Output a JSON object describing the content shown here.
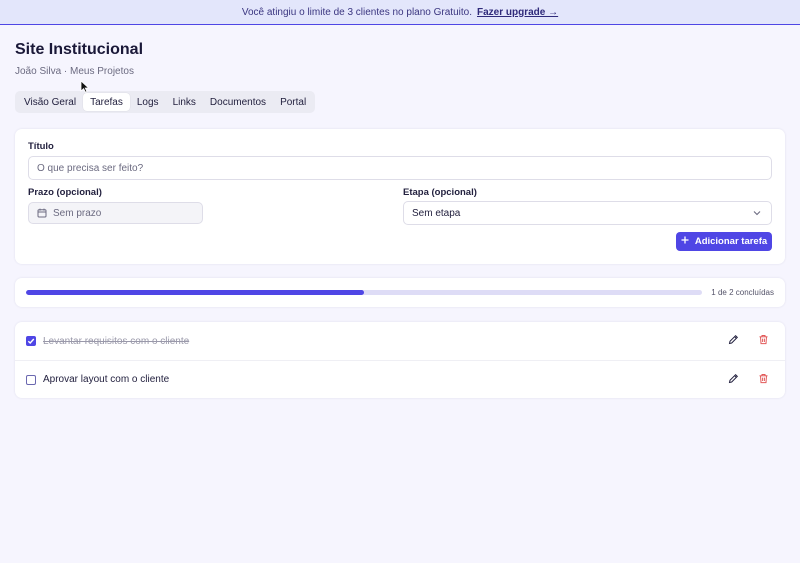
{
  "banner": {
    "message": "Você atingiu o limite de 3 clientes no plano Gratuito.",
    "link": "Fazer upgrade →"
  },
  "header": {
    "title": "Site Institucional",
    "breadcrumb": "João Silva · Meus Projetos"
  },
  "tabs": [
    {
      "label": "Visão Geral",
      "active": false
    },
    {
      "label": "Tarefas",
      "active": true
    },
    {
      "label": "Logs",
      "active": false
    },
    {
      "label": "Links",
      "active": false
    },
    {
      "label": "Documentos",
      "active": false
    },
    {
      "label": "Portal",
      "active": false
    }
  ],
  "form": {
    "title_label": "Título",
    "title_placeholder": "O que precisa ser feito?",
    "due_label": "Prazo (opcional)",
    "due_value": "Sem prazo",
    "stage_label": "Etapa (opcional)",
    "stage_value": "Sem etapa",
    "add_button": "Adicionar tarefa"
  },
  "progress": {
    "completed": 1,
    "total": 2,
    "text": "1 de 2 concluídas"
  },
  "tasks": [
    {
      "text": "Levantar requisitos com o cliente",
      "done": true
    },
    {
      "text": "Aprovar layout com o cliente",
      "done": false
    }
  ],
  "colors": {
    "accent": "#4f46e5",
    "danger": "#e25a5a"
  },
  "icons": {
    "calendar": "calendar-icon",
    "chevron": "chevron-down-icon",
    "plus": "plus-icon",
    "edit": "pencil-icon",
    "delete": "trash-icon",
    "check": "check-icon"
  }
}
